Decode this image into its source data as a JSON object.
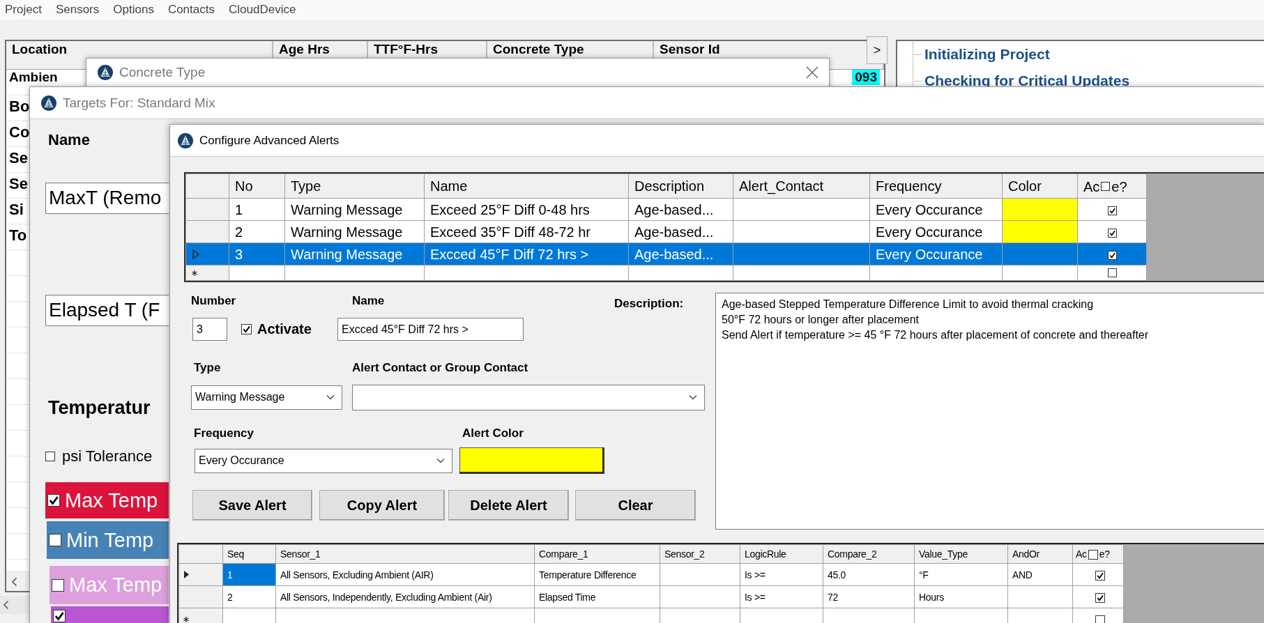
{
  "menu": [
    {
      "label": "Project"
    },
    {
      "label": "Sensors"
    },
    {
      "label": "Options"
    },
    {
      "label": "Contacts"
    },
    {
      "label": "CloudDevice"
    }
  ],
  "main_grid": {
    "columns": [
      "Location",
      "Age Hrs",
      "TTF°F-Hrs",
      "Concrete Type",
      "Sensor Id"
    ],
    "rows": [
      {
        "location": "Ambien",
        "sensor_id": "093"
      },
      {
        "location": "Bo"
      },
      {
        "location": "Co"
      },
      {
        "location": "Se"
      },
      {
        "location": "Se"
      },
      {
        "location": "Si"
      },
      {
        "location": "To"
      }
    ]
  },
  "scroll_button": ">",
  "status_tree": {
    "items": [
      "Initializing Project",
      "Checking for Critical Updates"
    ]
  },
  "concrete_window": {
    "title": "Concrete Type"
  },
  "targets_window": {
    "title": "Targets For: Standard Mix",
    "name_label": "Name",
    "fields": [
      "MaxT (Remo",
      "Elapsed T (F"
    ],
    "heading": "Temperatur",
    "psi_tolerance": {
      "label": "psi Tolerance",
      "checked": false
    },
    "series": [
      {
        "label": "Max Temp",
        "checked": true,
        "color": "#dc143c"
      },
      {
        "label": "Min Temp",
        "checked": false,
        "color": "#4682b4"
      },
      {
        "label": "Max Temp",
        "checked": false,
        "color": "#dda0dd"
      },
      {
        "checked": true,
        "color": "#ba55d3"
      }
    ]
  },
  "alerts_window": {
    "title": "Configure Advanced Alerts",
    "alerts_grid": {
      "columns": [
        "No",
        "Type",
        "Name",
        "Description",
        "Alert_Contact",
        "Frequency",
        "Color"
      ],
      "active_header": {
        "left": "Ac",
        "right": "e?",
        "checked": false
      },
      "rows": [
        {
          "kind": "alert",
          "selected": false,
          "no": "1",
          "type": "Warning Message",
          "name": "Exceed 25°F Diff 0-48 hrs",
          "description": "Age-based...",
          "frequency": "Every Occurance",
          "color": "#ffff00",
          "active": true
        },
        {
          "kind": "alert",
          "selected": false,
          "no": "2",
          "type": "Warning Message",
          "name": "Exceed 35°F Diff 48-72 hr",
          "description": "Age-based...",
          "frequency": "Every Occurance",
          "color": "#ffff00",
          "active": true
        },
        {
          "kind": "alert",
          "selected": true,
          "no": "3",
          "type": "Warning Message",
          "name": "Excced 45°F Diff 72 hrs >",
          "description": "Age-based...",
          "frequency": "Every Occurance",
          "active": true
        },
        {
          "kind": "new",
          "selected": false,
          "active": false
        }
      ]
    },
    "form": {
      "number_label": "Number",
      "number": "3",
      "activate": {
        "label": "Activate",
        "checked": true
      },
      "name_label": "Name",
      "name": "Excced 45°F Diff 72 hrs >",
      "description_label": "Description:",
      "description": "Age-based Stepped Temperature Difference Limit to avoid thermal cracking\n50°F 72 hours or longer after placement\nSend Alert if temperature >= 45 °F 72 hours after placement of concrete and thereafter",
      "type_label": "Type",
      "type": "Warning Message",
      "contact_label": "Alert Contact or Group Contact",
      "frequency_label": "Frequency",
      "frequency": "Every Occurance",
      "color_label": "Alert Color",
      "alert_color_swatch": {
        "color": "#ffff00"
      },
      "buttons": [
        "Save Alert",
        "Copy Alert",
        "Delete Alert",
        "Clear"
      ]
    },
    "rules_grid": {
      "columns": [
        "Seq",
        "Sensor_1",
        "Compare_1",
        "Sensor_2",
        "LogicRule",
        "Compare_2",
        "Value_Type",
        "AndOr"
      ],
      "active_header": {
        "left": "Ac",
        "right": "e?",
        "checked": false
      },
      "rows": [
        {
          "kind": "rule",
          "selected": true,
          "seq": "1",
          "sensor_1": "All Sensors, Excluding Ambient (AIR)",
          "compare_1": "Temperature Difference",
          "logic_rule": "Is >=",
          "compare_2": "45.0",
          "value_type": "°F",
          "and_or": "AND",
          "active": true
        },
        {
          "kind": "rule",
          "selected": false,
          "seq": "2",
          "sensor_1": "All Sensors, Independently, Excluding Ambient (Air)",
          "compare_1": "Elapsed Time",
          "logic_rule": "Is >=",
          "compare_2": "72",
          "value_type": "Hours",
          "active": true
        },
        {
          "kind": "new",
          "selected": false,
          "active": false
        }
      ]
    }
  }
}
